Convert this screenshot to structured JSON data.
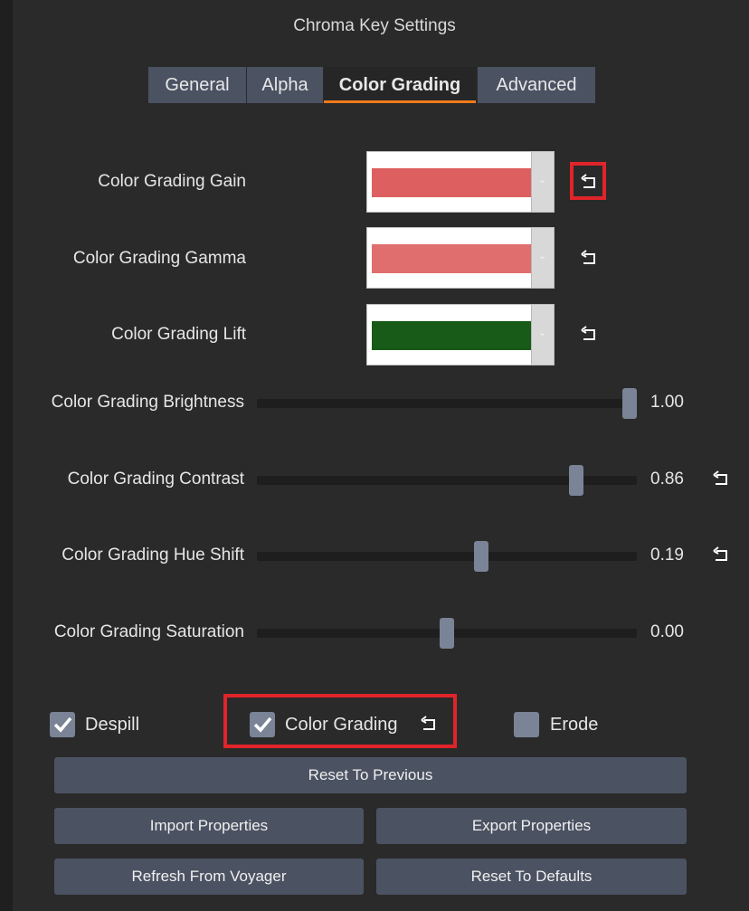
{
  "window": {
    "title": "Chroma Key Settings"
  },
  "tabs": [
    {
      "label": "General"
    },
    {
      "label": "Alpha"
    },
    {
      "label": "Color Grading"
    },
    {
      "label": "Advanced"
    }
  ],
  "active_tab": "Color Grading",
  "color_rows": [
    {
      "label": "Color Grading Gain",
      "color": "#de5f5f"
    },
    {
      "label": "Color Grading Gamma",
      "color": "#e06e6e"
    },
    {
      "label": "Color Grading Lift",
      "color": "#185a18"
    }
  ],
  "sliders": [
    {
      "label": "Color Grading Brightness",
      "value": "1.00",
      "fraction": 0.98
    },
    {
      "label": "Color Grading Contrast",
      "value": "0.86",
      "fraction": 0.84
    },
    {
      "label": "Color Grading Hue Shift",
      "value": "0.19",
      "fraction": 0.59
    },
    {
      "label": "Color Grading Saturation",
      "value": "0.00",
      "fraction": 0.5
    }
  ],
  "checkboxes": [
    {
      "label": "Despill",
      "checked": true
    },
    {
      "label": "Color Grading",
      "checked": true
    },
    {
      "label": "Erode",
      "checked": false
    }
  ],
  "buttons": {
    "reset_previous": "Reset To Previous",
    "import": "Import Properties",
    "export": "Export Properties",
    "refresh": "Refresh From Voyager",
    "reset_defaults": "Reset To Defaults"
  },
  "icons": {
    "reset": "undo-arrow-icon",
    "dropdown": "chevron-down-icon",
    "check": "checkmark-icon"
  },
  "colors": {
    "accent": "#f07a1a",
    "highlight": "#e0242a",
    "button": "#4b5262"
  }
}
